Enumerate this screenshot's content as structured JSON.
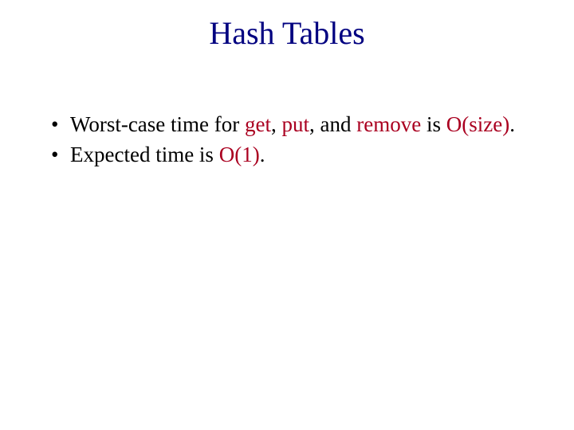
{
  "title": "Hash Tables",
  "bullets": [
    {
      "pre": "Worst-case time for ",
      "k1": "get",
      "mid1": ", ",
      "k2": "put",
      "mid2": ", and ",
      "k3": "remove",
      "mid3": " is ",
      "o": "O(size)",
      "post": "."
    },
    {
      "pre": "Expected time is ",
      "o": "O(1)",
      "post": "."
    }
  ]
}
